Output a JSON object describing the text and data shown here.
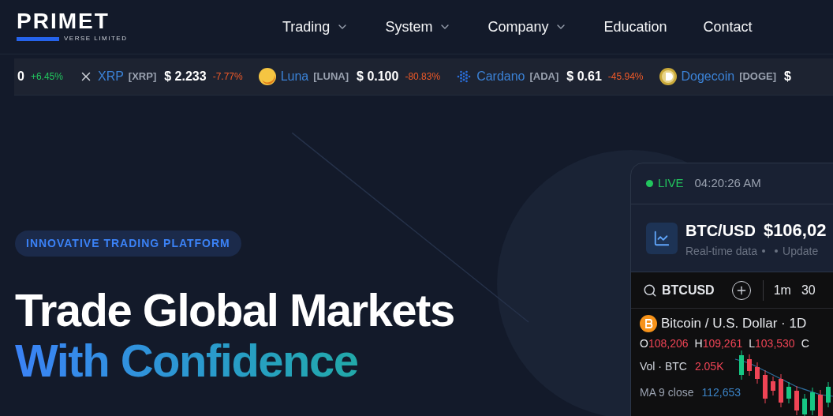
{
  "logo": {
    "name": "PRIMET",
    "tagline": "VERSE LIMITED"
  },
  "nav": [
    {
      "label": "Trading",
      "has_menu": true
    },
    {
      "label": "System",
      "has_menu": true
    },
    {
      "label": "Company",
      "has_menu": true
    },
    {
      "label": "Education",
      "has_menu": false
    },
    {
      "label": "Contact",
      "has_menu": false
    }
  ],
  "ticker": [
    {
      "kind": "partial",
      "price": "0",
      "change": "+6.45%",
      "color": "#22c55e"
    },
    {
      "kind": "xrp",
      "name": "XRP",
      "symbol": "[XRP]",
      "price": "$ 2.233",
      "change": "-7.77%",
      "color": "#f05a28"
    },
    {
      "kind": "luna",
      "name": "Luna",
      "symbol": "[LUNA]",
      "price": "$ 0.100",
      "change": "-80.83%",
      "color": "#f05a28"
    },
    {
      "kind": "cardano",
      "name": "Cardano",
      "symbol": "[ADA]",
      "price": "$ 0.61",
      "change": "-45.94%",
      "color": "#f05a28"
    },
    {
      "kind": "doge",
      "name": "Dogecoin",
      "symbol": "[DOGE]",
      "price": "$"
    }
  ],
  "hero": {
    "badge": "INNOVATIVE TRADING PLATFORM",
    "title_line_1": "Trade Global Markets",
    "title_line_2": "With Confidence"
  },
  "card": {
    "status": "LIVE",
    "time": "04:20:26 AM",
    "pair": "BTC/USD",
    "price": "$106,02",
    "subtitle_1": "Real-time data",
    "subtitle_2": "Update",
    "search": "BTCUSD",
    "intervals": [
      "1m",
      "30"
    ],
    "instrument": "Bitcoin / U.S. Dollar · 1D",
    "ohlc": [
      {
        "key": "O",
        "value": "108,206"
      },
      {
        "key": "H",
        "value": "109,261"
      },
      {
        "key": "L",
        "value": "103,530"
      },
      {
        "key": "C"
      }
    ],
    "volume_label": "Vol · BTC",
    "volume": "2.05K",
    "ma_label": "MA 9 close",
    "ma_value": "112,653"
  }
}
